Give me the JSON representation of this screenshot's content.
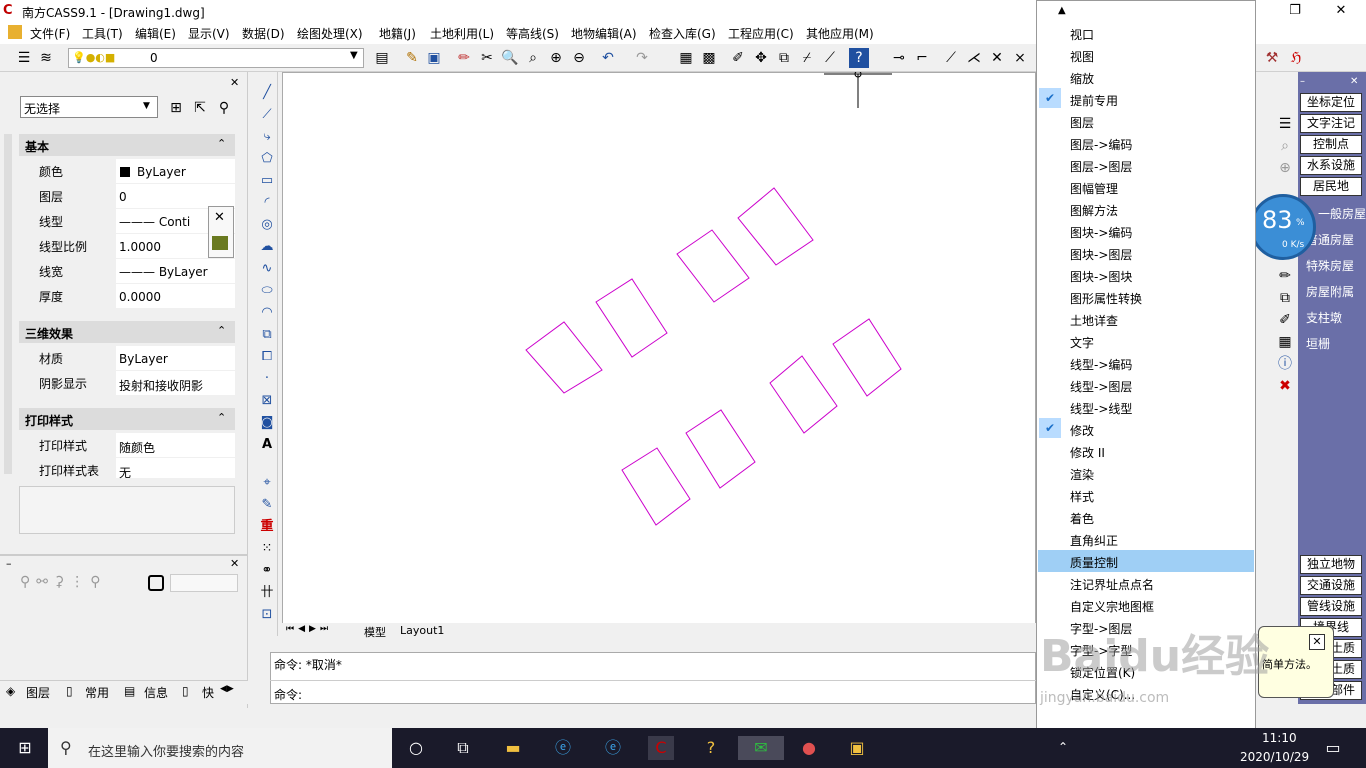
{
  "window": {
    "title": "南方CASS9.1 - [Drawing1.dwg]",
    "logo": "C",
    "minimize": "—",
    "restore": "❐",
    "close": "✕"
  },
  "menu": [
    "文件(F)",
    "工具(T)",
    "编辑(E)",
    "显示(V)",
    "数据(D)",
    "绘图处理(X)",
    "地籍(J)",
    "土地利用(L)",
    "等高线(S)",
    "地物编辑(A)",
    "检查入库(G)",
    "工程应用(C)",
    "其他应用(M)"
  ],
  "toolbar": {
    "layer_value": "0"
  },
  "properties": {
    "selection": "无选择",
    "sections": [
      {
        "title": "基本",
        "rows": [
          {
            "label": "颜色",
            "value": "ByLayer"
          },
          {
            "label": "图层",
            "value": "0"
          },
          {
            "label": "线型",
            "value": "——— Conti"
          },
          {
            "label": "线型比例",
            "value": "1.0000"
          },
          {
            "label": "线宽",
            "value": "——— ByLayer"
          },
          {
            "label": "厚度",
            "value": "0.0000"
          }
        ]
      },
      {
        "title": "三维效果",
        "rows": [
          {
            "label": "材质",
            "value": "ByLayer"
          },
          {
            "label": "阴影显示",
            "value": "投射和接收阴影"
          }
        ]
      },
      {
        "title": "打印样式",
        "rows": [
          {
            "label": "打印样式",
            "value": "随颜色"
          },
          {
            "label": "打印样式表",
            "value": "无"
          }
        ]
      }
    ]
  },
  "bottom_tabs": [
    "图层",
    "常用",
    "信息",
    "快"
  ],
  "canvas_tabs": [
    "模型",
    "Layout1"
  ],
  "command": {
    "line1": "命令: *取消*",
    "line2": "命令:"
  },
  "context_menu": {
    "items": [
      "视口",
      "视图",
      "缩放",
      "提前专用",
      "图层",
      "图层->编码",
      "图层->图层",
      "图幅管理",
      "图解方法",
      "图块->编码",
      "图块->图层",
      "图块->图块",
      "图形属性转换",
      "土地详查",
      "文字",
      "线型->编码",
      "线型->图层",
      "线型->线型",
      "修改",
      "修改 II",
      "渲染",
      "样式",
      "着色",
      "直角纠正",
      "质量控制",
      "注记界址点点名",
      "自定义宗地图框",
      "字型->图层",
      "字型->字型",
      "锁定位置(K)",
      "自定义(C)..."
    ],
    "checked": [
      "提前专用",
      "修改"
    ],
    "highlighted": "质量控制"
  },
  "right_panel": {
    "buttons": [
      "坐标定位",
      "文字注记",
      "控制点",
      "水系设施",
      "居民地"
    ],
    "items": [
      "一般房屋",
      "普通房屋",
      "特殊房屋",
      "房屋附属",
      "支柱墩",
      "垣栅"
    ],
    "bottom_buttons": [
      "独立地物",
      "交通设施",
      "管线设施",
      "境界线",
      "地貌土质",
      "植被土质",
      "市政部件"
    ]
  },
  "speed_widget": {
    "value": "83",
    "unit": "%",
    "rate": "0 K/s"
  },
  "tooltip": {
    "text": "简单方法。"
  },
  "taskbar": {
    "search_placeholder": "在这里输入你要搜索的内容",
    "time": "11:10",
    "date": "2020/10/29"
  },
  "watermark": {
    "text": "Baidu经验",
    "url": "jingyan.baidu.com"
  },
  "colors": {
    "drawing_lines": "#cc00cc",
    "highlight": "#9fcff5",
    "right_panel": "#6a6fa8"
  }
}
